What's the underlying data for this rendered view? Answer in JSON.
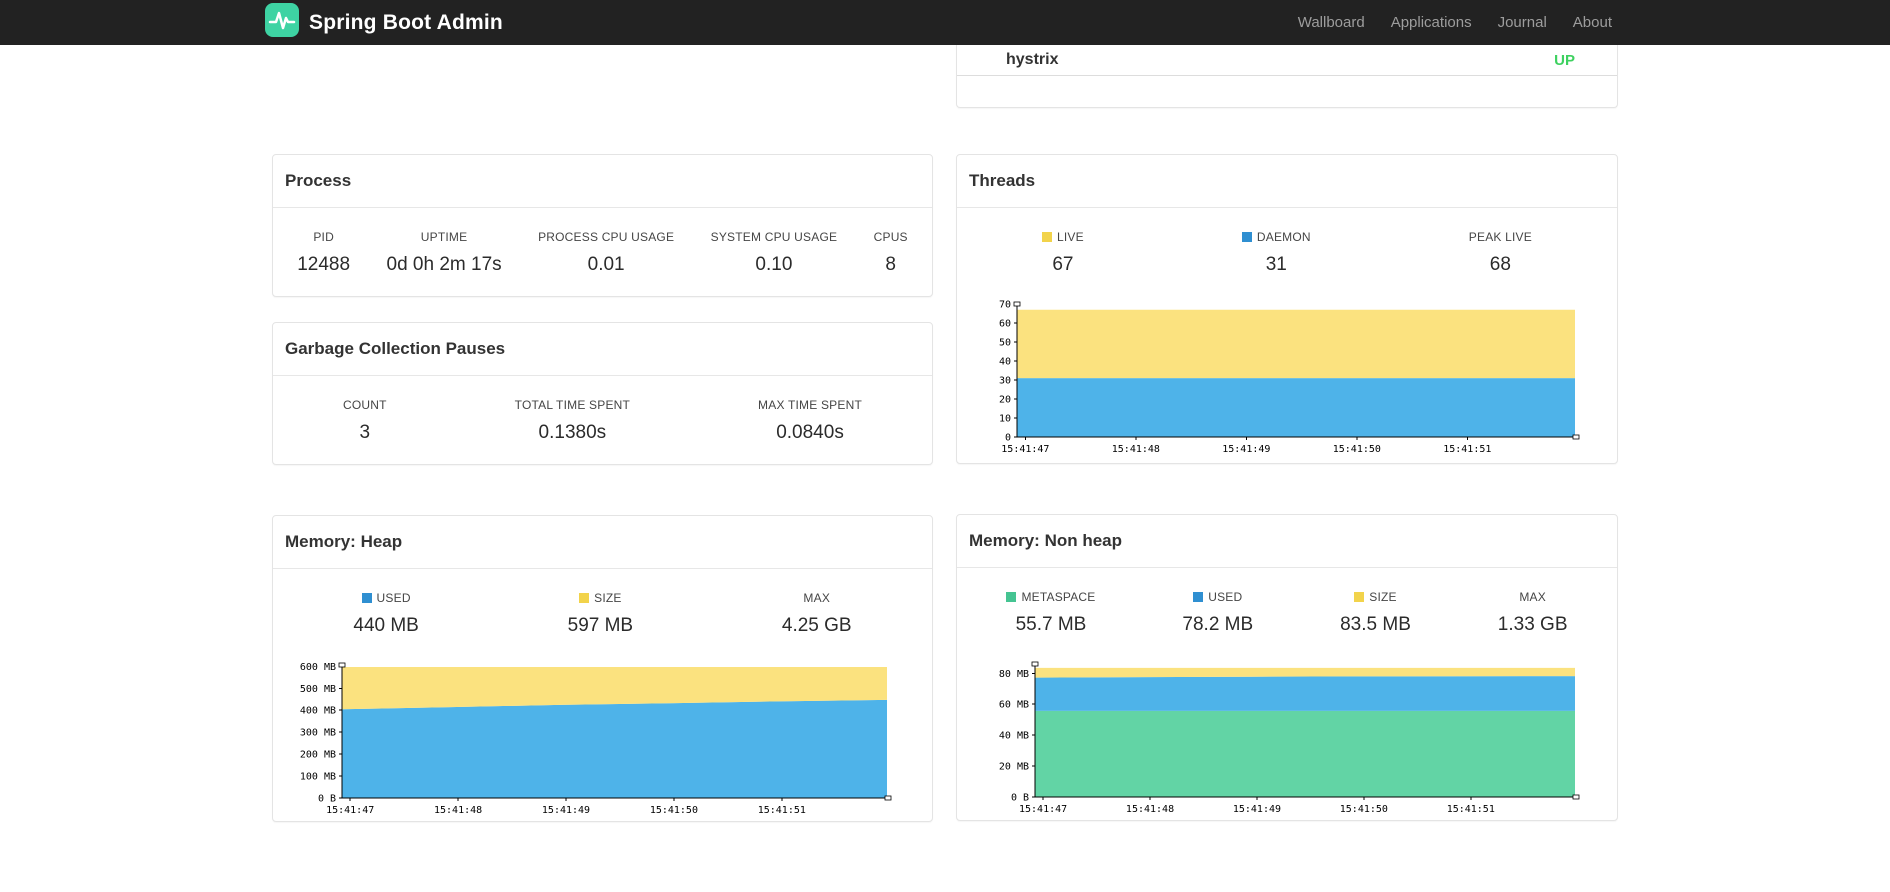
{
  "navbar": {
    "brand": "Spring Boot Admin",
    "links": [
      {
        "label": "Wallboard"
      },
      {
        "label": "Applications"
      },
      {
        "label": "Journal"
      },
      {
        "label": "About"
      }
    ]
  },
  "applications_panel": {
    "rows": [
      {
        "name": "hystrix",
        "status": "UP",
        "status_color": "#3ed160"
      }
    ]
  },
  "panels": {
    "process": {
      "title": "Process",
      "stats": [
        {
          "label": "PID",
          "value": "12488"
        },
        {
          "label": "UPTIME",
          "value": "0d 0h 2m 17s"
        },
        {
          "label": "PROCESS CPU USAGE",
          "value": "0.01"
        },
        {
          "label": "SYSTEM CPU USAGE",
          "value": "0.10"
        },
        {
          "label": "CPUS",
          "value": "8"
        }
      ]
    },
    "gc": {
      "title": "Garbage Collection Pauses",
      "stats": [
        {
          "label": "COUNT",
          "value": "3"
        },
        {
          "label": "TOTAL TIME SPENT",
          "value": "0.1380s"
        },
        {
          "label": "MAX TIME SPENT",
          "value": "0.0840s"
        }
      ]
    },
    "threads": {
      "title": "Threads",
      "stats": [
        {
          "label": "LIVE",
          "value": "67",
          "color": "#f2d34b"
        },
        {
          "label": "DAEMON",
          "value": "31",
          "color": "#2f8fd1"
        },
        {
          "label": "PEAK LIVE",
          "value": "68"
        }
      ]
    },
    "heap": {
      "title": "Memory: Heap",
      "stats": [
        {
          "label": "USED",
          "value": "440 MB",
          "color": "#2f8fd1"
        },
        {
          "label": "SIZE",
          "value": "597 MB",
          "color": "#f2d34b"
        },
        {
          "label": "MAX",
          "value": "4.25 GB"
        }
      ]
    },
    "nonheap": {
      "title": "Memory: Non heap",
      "stats": [
        {
          "label": "METASPACE",
          "value": "55.7 MB",
          "color": "#45c492"
        },
        {
          "label": "USED",
          "value": "78.2 MB",
          "color": "#2f8fd1"
        },
        {
          "label": "SIZE",
          "value": "83.5 MB",
          "color": "#f2d34b"
        },
        {
          "label": "MAX",
          "value": "1.33 GB"
        }
      ]
    }
  },
  "colors": {
    "brand_green": "#3ed3a3",
    "navbar_bg": "#222222",
    "area_blue": "#4eb3e9",
    "area_yellow": "#fbe27f",
    "area_green": "#62d4a5",
    "status_up": "#3ed160"
  },
  "chart_data": [
    {
      "id": "threads-chart",
      "type": "area",
      "stacked": true,
      "title": "Threads",
      "xlabel": "",
      "ylabel": "",
      "ylim": [
        0,
        70
      ],
      "x_tick_labels": [
        "15:41:47",
        "15:41:48",
        "15:41:49",
        "15:41:50",
        "15:41:51"
      ],
      "y_ticks": [
        {
          "v": 0,
          "label": "0"
        },
        {
          "v": 10,
          "label": "10"
        },
        {
          "v": 20,
          "label": "20"
        },
        {
          "v": 30,
          "label": "30"
        },
        {
          "v": 40,
          "label": "40"
        },
        {
          "v": 50,
          "label": "50"
        },
        {
          "v": 60,
          "label": "60"
        },
        {
          "v": 70,
          "label": "70"
        }
      ],
      "series": [
        {
          "name": "DAEMON",
          "color": "#4eb3e9",
          "values": [
            31,
            31,
            31,
            31,
            31,
            31
          ]
        },
        {
          "name": "LIVE",
          "color": "#fbe27f",
          "values": [
            67,
            67,
            67,
            67,
            67,
            67
          ]
        }
      ]
    },
    {
      "id": "heap-chart",
      "type": "area",
      "stacked": true,
      "title": "Memory: Heap",
      "xlabel": "",
      "ylabel": "",
      "ylim": [
        0,
        606
      ],
      "x_tick_labels": [
        "15:41:47",
        "15:41:48",
        "15:41:49",
        "15:41:50",
        "15:41:51"
      ],
      "y_ticks": [
        {
          "v": 0,
          "label": "0 B"
        },
        {
          "v": 100,
          "label": "100 MB"
        },
        {
          "v": 200,
          "label": "200 MB"
        },
        {
          "v": 300,
          "label": "300 MB"
        },
        {
          "v": 400,
          "label": "400 MB"
        },
        {
          "v": 500,
          "label": "500 MB"
        },
        {
          "v": 600,
          "label": "600 MB"
        }
      ],
      "series": [
        {
          "name": "USED",
          "color": "#4eb3e9",
          "values": [
            404,
            414,
            424,
            432,
            440,
            447
          ]
        },
        {
          "name": "SIZE",
          "color": "#fbe27f",
          "values": [
            597,
            597,
            597,
            597,
            597,
            597
          ]
        }
      ]
    },
    {
      "id": "nonheap-chart",
      "type": "area",
      "stacked": true,
      "title": "Memory: Non heap",
      "xlabel": "",
      "ylabel": "",
      "ylim": [
        0,
        86
      ],
      "x_tick_labels": [
        "15:41:47",
        "15:41:48",
        "15:41:49",
        "15:41:50",
        "15:41:51"
      ],
      "y_ticks": [
        {
          "v": 0,
          "label": "0 B"
        },
        {
          "v": 20,
          "label": "20 MB"
        },
        {
          "v": 40,
          "label": "40 MB"
        },
        {
          "v": 60,
          "label": "60 MB"
        },
        {
          "v": 80,
          "label": "80 MB"
        }
      ],
      "series": [
        {
          "name": "METASPACE",
          "color": "#62d4a5",
          "values": [
            55.7,
            55.7,
            55.7,
            55.7,
            55.7,
            55.7
          ]
        },
        {
          "name": "USED",
          "color": "#4eb3e9",
          "values": [
            77.2,
            77.5,
            77.8,
            78.0,
            78.1,
            78.2
          ]
        },
        {
          "name": "SIZE",
          "color": "#fbe27f",
          "values": [
            83.5,
            83.5,
            83.5,
            83.5,
            83.5,
            83.5
          ]
        }
      ]
    }
  ]
}
